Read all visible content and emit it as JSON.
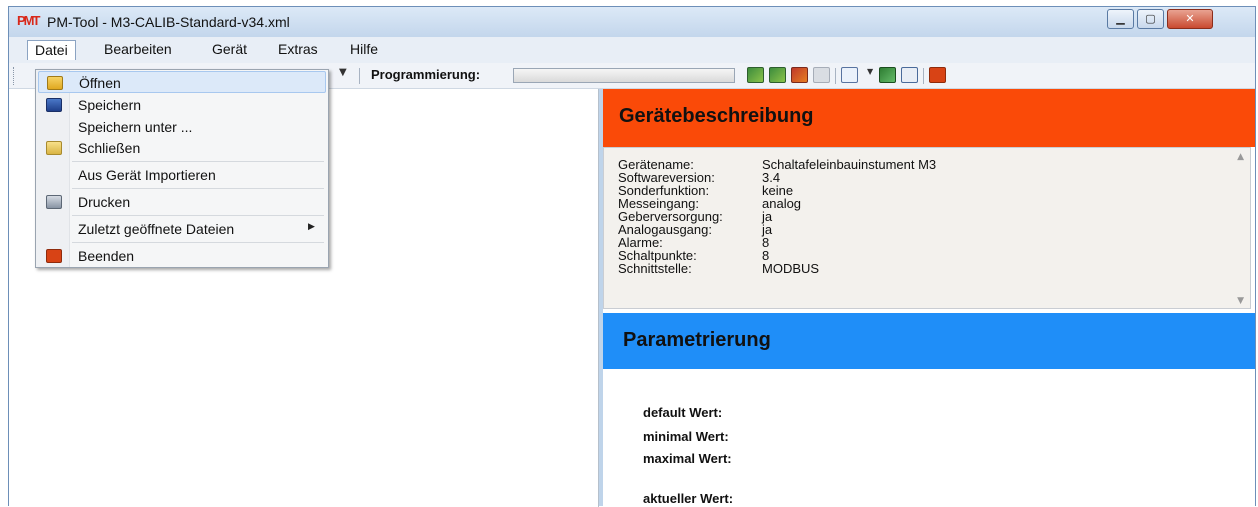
{
  "window": {
    "title": "PM-Tool - M3-CALIB-Standard-v34.xml",
    "app_icon_text": "PMT",
    "controls": {
      "minimize": "▁",
      "maximize": "▢",
      "close": "✕"
    }
  },
  "menubar": {
    "items": [
      {
        "label": "Datei"
      },
      {
        "label": "Bearbeiten"
      },
      {
        "label": "Gerät"
      },
      {
        "label": "Extras"
      },
      {
        "label": "Hilfe"
      }
    ]
  },
  "toolbar": {
    "programming_label": "Programmierung:",
    "programming_progress": 0
  },
  "datei_menu": {
    "items": [
      {
        "label": "Öffnen",
        "icon": "folder-open-icon",
        "highlighted": true
      },
      {
        "label": "Speichern",
        "icon": "save-icon"
      },
      {
        "label": "Speichern unter ..."
      },
      {
        "label": "Schließen",
        "icon": "folder-icon"
      },
      {
        "label": "Aus Gerät Importieren"
      },
      {
        "label": "Drucken",
        "icon": "printer-icon"
      },
      {
        "label": "Zuletzt geöffnete Dateien",
        "submenu": true
      },
      {
        "label": "Beenden",
        "icon": "power-icon"
      }
    ]
  },
  "device_description": {
    "title": "Gerätebeschreibung",
    "rows": [
      {
        "key": "Gerätename:",
        "value": "Schaltafeleinbauinstument M3"
      },
      {
        "key": "Softwareversion:",
        "value": "3.4"
      },
      {
        "key": "Sonderfunktion:",
        "value": "keine"
      },
      {
        "key": "Messeingang:",
        "value": "analog"
      },
      {
        "key": "Geberversorgung:",
        "value": "ja"
      },
      {
        "key": "Analogausgang:",
        "value": "ja"
      },
      {
        "key": "Alarme:",
        "value": "8"
      },
      {
        "key": "Schaltpunkte:",
        "value": "8"
      },
      {
        "key": "Schnittstelle:",
        "value": "MODBUS"
      }
    ]
  },
  "parametrization": {
    "title": "Parametrierung",
    "default_label": "default Wert:",
    "min_label": "minimal Wert:",
    "max_label": "maximal Wert:",
    "current_label": "aktueller Wert:"
  },
  "colors": {
    "desc_header": "#fa4a08",
    "param_header": "#1f8ef8"
  }
}
